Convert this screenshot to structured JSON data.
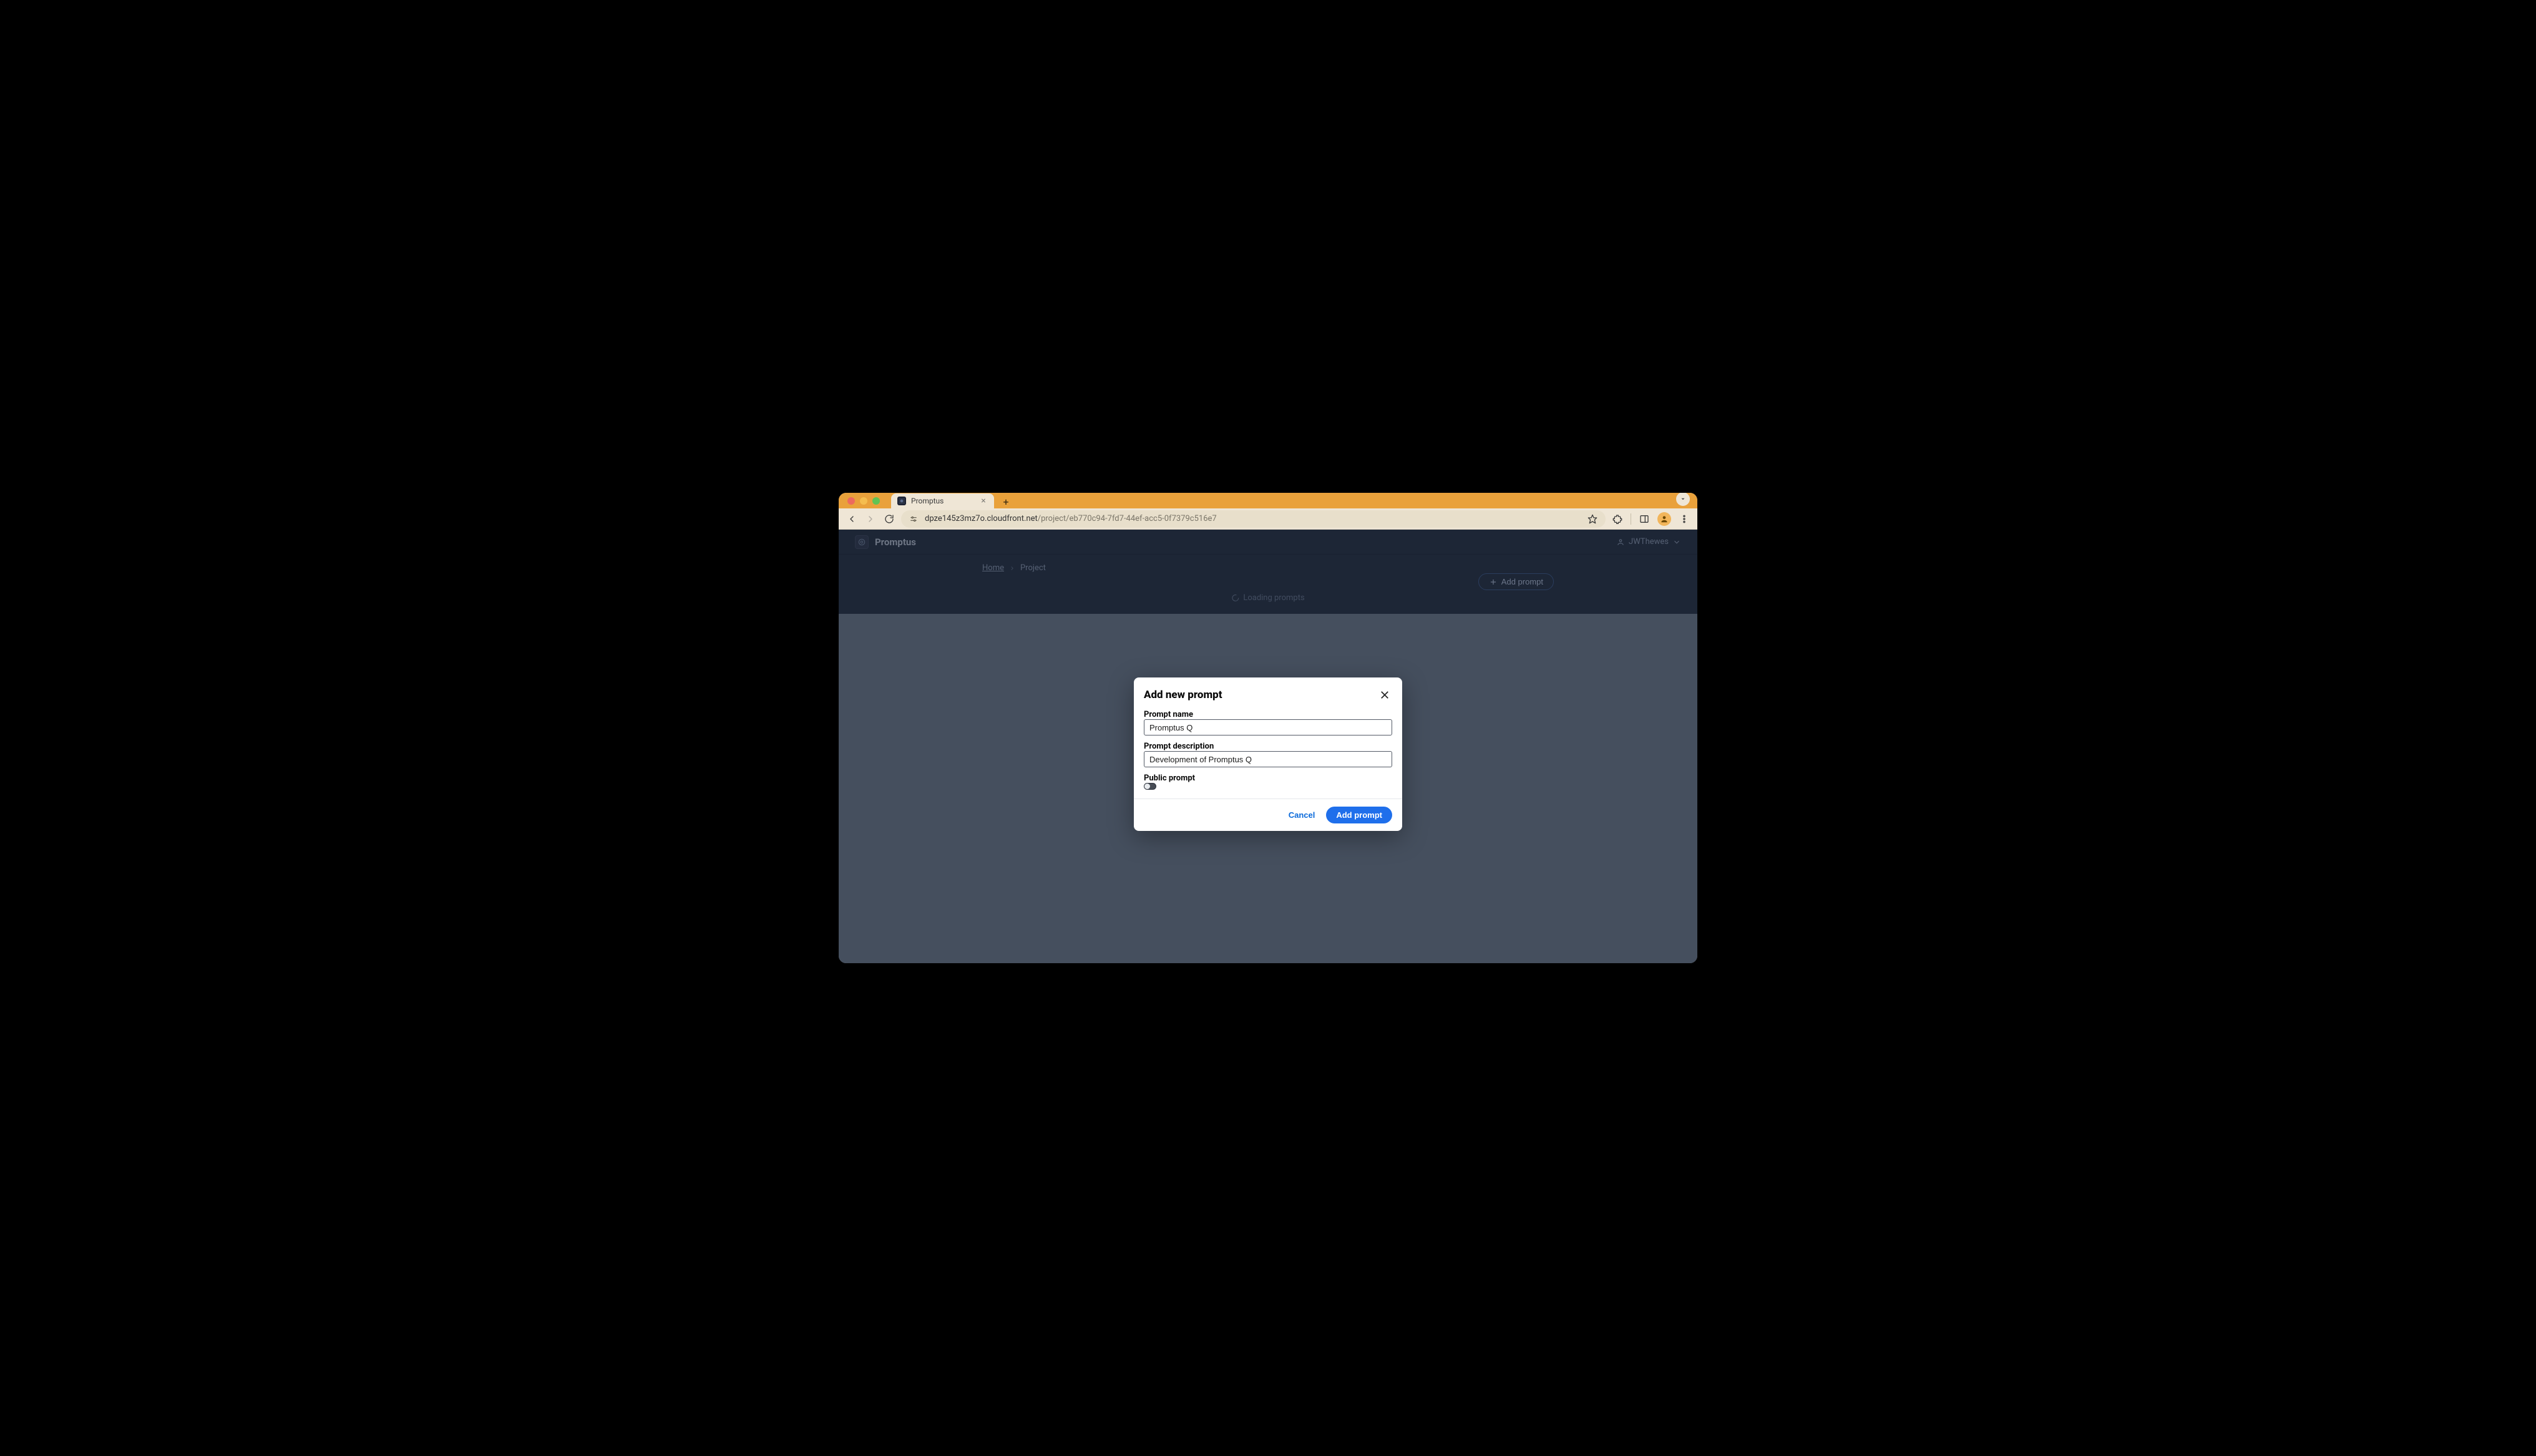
{
  "browser": {
    "tab_title": "Promptus",
    "url_host": "dpze145z3mz7o.cloudfront.net",
    "url_path": "/project/eb770c94-7fd7-44ef-acc5-0f7379c516e7"
  },
  "app": {
    "name": "Promptus",
    "user": "JWThewes",
    "breadcrumb": {
      "home": "Home",
      "current": "Project"
    },
    "add_prompt_button": "Add prompt",
    "loading_text": "Loading prompts"
  },
  "modal": {
    "title": "Add new prompt",
    "fields": {
      "name_label": "Prompt name",
      "name_value": "Promptus Q",
      "desc_label": "Prompt description",
      "desc_value": "Development of Promptus Q",
      "public_label": "Public prompt",
      "public_on": false
    },
    "buttons": {
      "cancel": "Cancel",
      "submit": "Add prompt"
    }
  }
}
